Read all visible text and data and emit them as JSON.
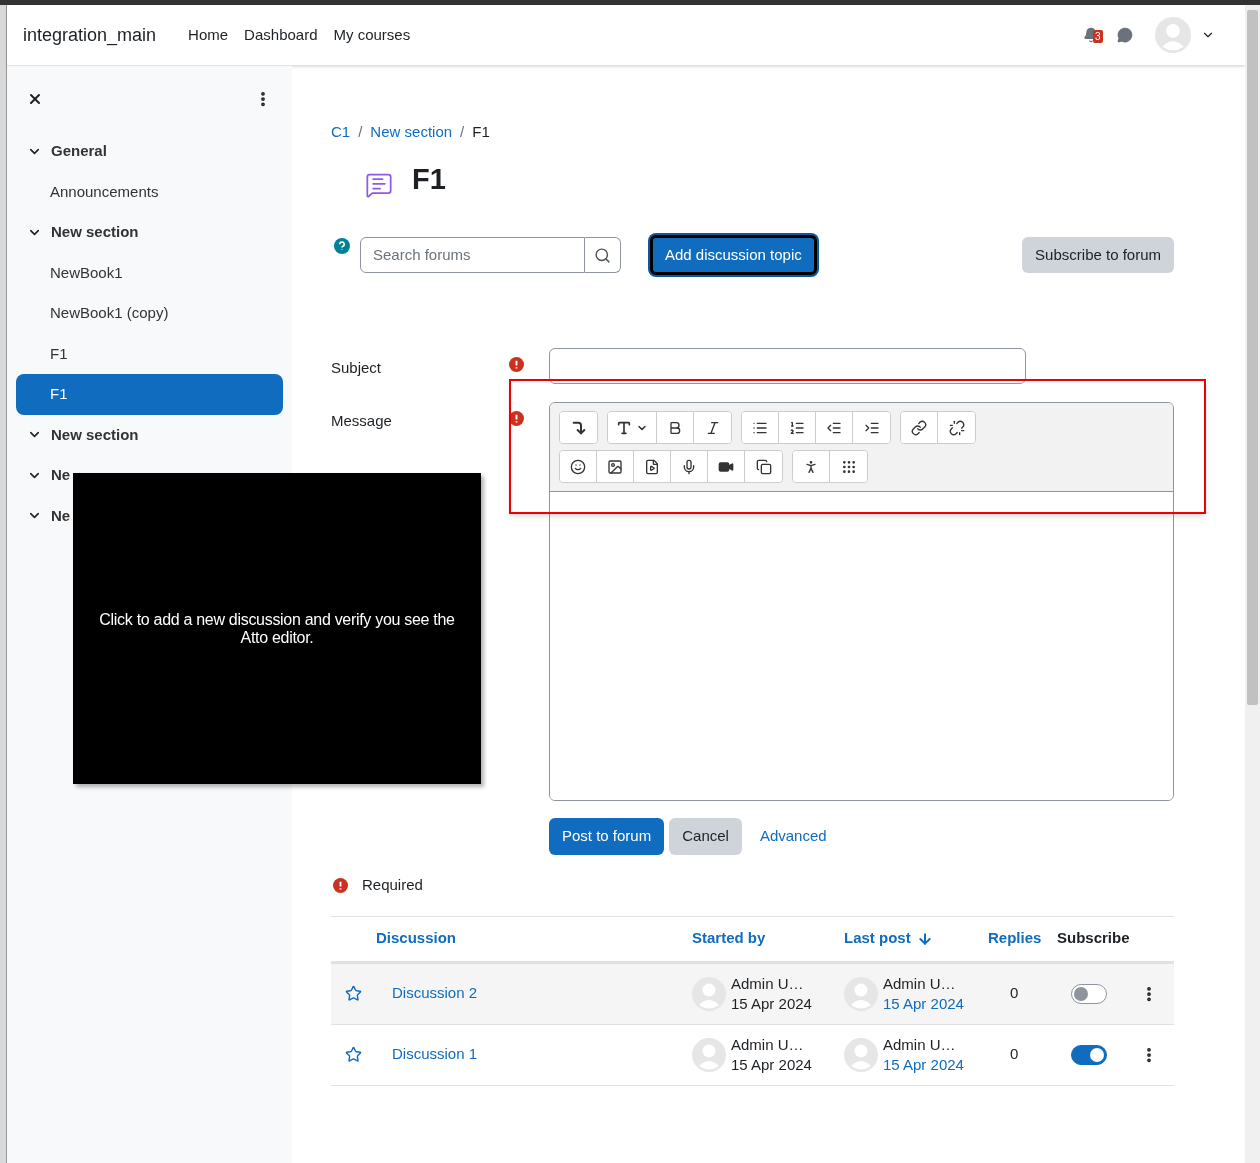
{
  "navbar": {
    "site_name": "integration_main",
    "links": [
      "Home",
      "Dashboard",
      "My courses"
    ],
    "notification_count": "3"
  },
  "drawer": {
    "items": [
      {
        "kind": "section",
        "label": "General",
        "expanded": true,
        "selected": false
      },
      {
        "kind": "activity",
        "label": "Announcements",
        "selected": false
      },
      {
        "kind": "section",
        "label": "New section",
        "expanded": true,
        "selected": false
      },
      {
        "kind": "activity",
        "label": "NewBook1",
        "selected": false
      },
      {
        "kind": "activity",
        "label": "NewBook1 (copy)",
        "selected": false
      },
      {
        "kind": "activity",
        "label": "F1",
        "selected": false
      },
      {
        "kind": "activity",
        "label": "F1",
        "selected": true
      },
      {
        "kind": "section",
        "label": "New section",
        "expanded": true,
        "selected": false
      },
      {
        "kind": "section",
        "label": "Ne",
        "expanded": true,
        "selected": false
      },
      {
        "kind": "section",
        "label": "Ne",
        "expanded": true,
        "selected": false
      }
    ]
  },
  "breadcrumb": {
    "separator": "/",
    "items": [
      "C1",
      "New section",
      "F1"
    ]
  },
  "title": "F1",
  "search": {
    "placeholder": "Search forums"
  },
  "add_button": "Add discussion topic",
  "subscribe_button": "Subscribe to forum",
  "form": {
    "subject_label": "Subject",
    "message_label": "Message",
    "actions": [
      "Post to forum",
      "Cancel",
      "Advanced"
    ],
    "required_note": "Required"
  },
  "table": {
    "columns": [
      {
        "label": "Discussion",
        "sortable": true
      },
      {
        "label": "Started by",
        "sortable": true
      },
      {
        "label": "Last post",
        "sortable": true
      },
      {
        "label": "Replies",
        "sortable": true
      },
      {
        "label": "Subscribe",
        "sortable": false
      }
    ],
    "rows": [
      {
        "starred": false,
        "title": "Discussion 2",
        "started_by": "Admin U…",
        "started_date": "15 Apr 2024",
        "last_post_by": "Admin U…",
        "last_post_date": "15 Apr 2024",
        "replies": "0",
        "subscribed": false
      },
      {
        "starred": false,
        "title": "Discussion 1",
        "started_by": "Admin U…",
        "started_date": "15 Apr 2024",
        "last_post_by": "Admin U…",
        "last_post_date": "15 Apr 2024",
        "replies": "0",
        "subscribed": true
      }
    ]
  },
  "overlay": {
    "text": "Click to add a new discussion and verify you see the Atto editor."
  }
}
